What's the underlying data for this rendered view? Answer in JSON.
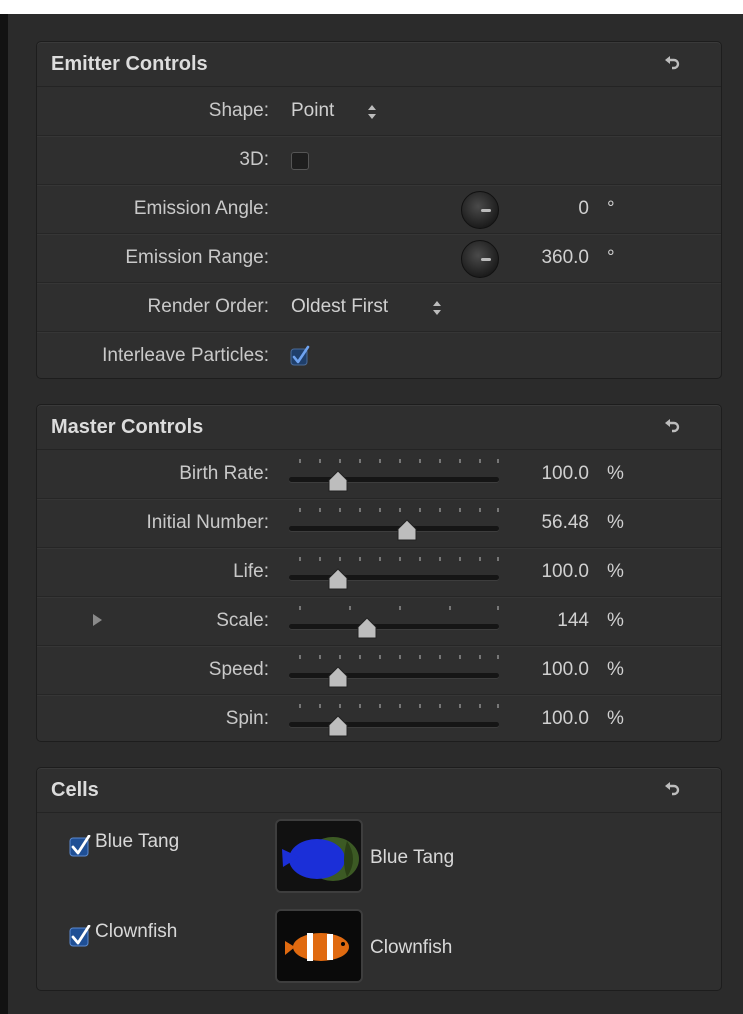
{
  "emitter": {
    "title": "Emitter Controls",
    "shape_label": "Shape:",
    "shape_value": "Point",
    "threed_label": "3D:",
    "threed_checked": false,
    "angle_label": "Emission Angle:",
    "angle_value": "0",
    "angle_unit": "°",
    "range_label": "Emission Range:",
    "range_value": "360.0",
    "range_unit": "°",
    "order_label": "Render Order:",
    "order_value": "Oldest First",
    "interleave_label": "Interleave Particles:",
    "interleave_checked": true
  },
  "master": {
    "title": "Master Controls",
    "rows": [
      {
        "label": "Birth Rate:",
        "value": "100.0",
        "unit": "%"
      },
      {
        "label": "Initial Number:",
        "value": "56.48",
        "unit": "%"
      },
      {
        "label": "Life:",
        "value": "100.0",
        "unit": "%"
      },
      {
        "label": "Scale:",
        "value": "144",
        "unit": "%"
      },
      {
        "label": "Speed:",
        "value": "100.0",
        "unit": "%"
      },
      {
        "label": "Spin:",
        "value": "100.0",
        "unit": "%"
      }
    ]
  },
  "cells": {
    "title": "Cells",
    "items": [
      {
        "label": "Blue Tang",
        "name": "Blue Tang",
        "checked": true
      },
      {
        "label": "Clownfish",
        "name": "Clownfish",
        "checked": true
      }
    ]
  },
  "colors": {
    "panel_bg": "#2f2f2f",
    "accent_blue": "#3b7ddd",
    "text": "#d8d8d8"
  },
  "icons": {
    "reset": "reset-arrow-icon",
    "updown": "updown-arrows-icon",
    "disclosure": "disclosure-triangle-icon",
    "check": "checkmark-icon"
  }
}
